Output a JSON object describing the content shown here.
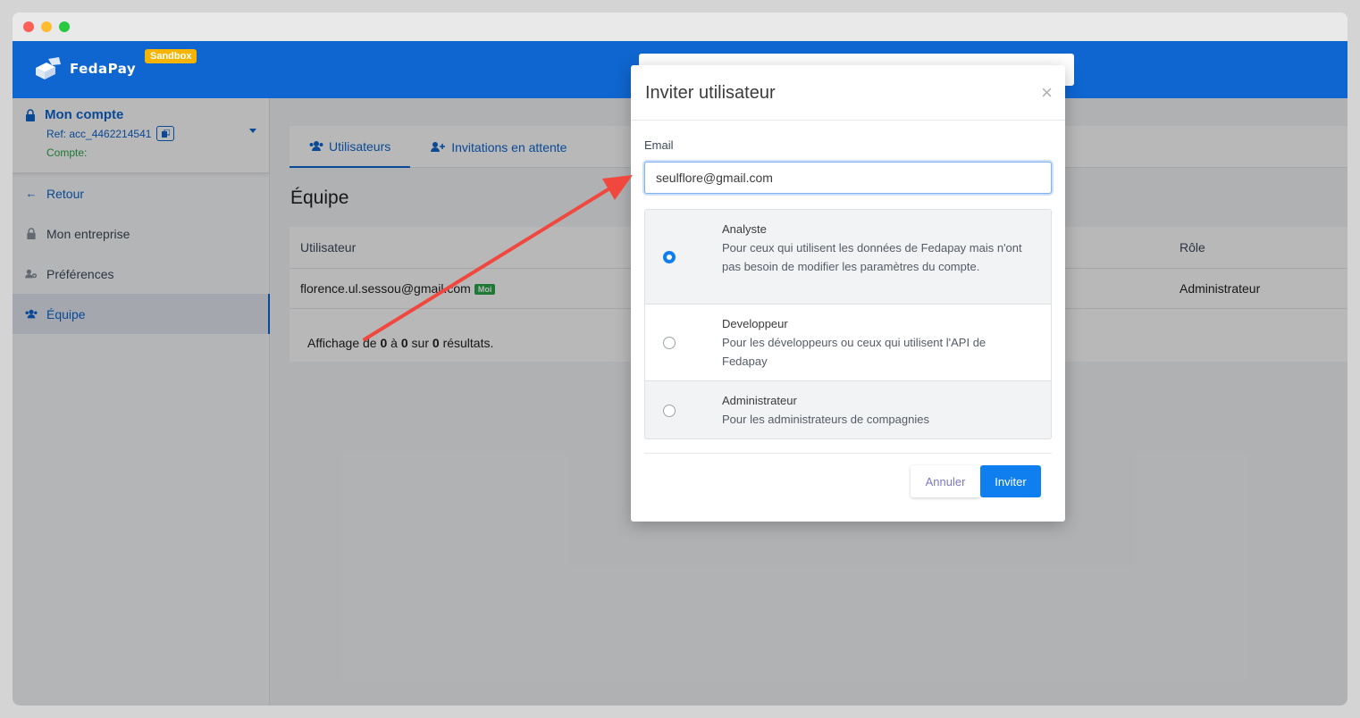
{
  "brand": {
    "name": "FedaPay",
    "env_badge": "Sandbox"
  },
  "sidebar": {
    "account": {
      "title": "Mon compte",
      "ref": "Ref: acc_4462214541",
      "compte": "Compte:"
    },
    "items": [
      {
        "label": "Retour",
        "icon": "arrow-left-icon"
      },
      {
        "label": "Mon entreprise",
        "icon": "lock-icon"
      },
      {
        "label": "Préférences",
        "icon": "user-gear-icon"
      },
      {
        "label": "Équipe",
        "icon": "users-icon",
        "active": true
      }
    ]
  },
  "main": {
    "tabs": [
      {
        "label": "Utilisateurs",
        "icon": "users-icon",
        "active": true
      },
      {
        "label": "Invitations en attente",
        "icon": "user-plus-icon"
      }
    ],
    "title": "Équipe",
    "table": {
      "headers": [
        "Utilisateur",
        "Rôle"
      ],
      "rows": [
        {
          "user": "florence.ul.sessou@gmail.com",
          "badge": "Moi",
          "role": "Administrateur"
        }
      ],
      "footer": {
        "prefix": "Affichage de ",
        "from": "0",
        "mid1": " à ",
        "to": "0",
        "mid2": " sur ",
        "total": "0",
        "suffix": " résultats."
      }
    }
  },
  "modal": {
    "title": "Inviter utilisateur",
    "close": "×",
    "email_label": "Email",
    "email_value": "seulflore@gmail.com",
    "roles": [
      {
        "name": "Analyste",
        "desc": "Pour ceux qui utilisent les données de Fedapay mais n'ont pas besoin de modifier les paramètres du compte.",
        "checked": true
      },
      {
        "name": "Developpeur",
        "desc": "Pour les développeurs ou ceux qui utilisent l'API de Fedapay",
        "checked": false
      },
      {
        "name": "Administrateur",
        "desc": "Pour les administrateurs de compagnies",
        "checked": false
      }
    ],
    "cancel_label": "Annuler",
    "submit_label": "Inviter"
  },
  "colors": {
    "brand_blue": "#0f66d0",
    "primary_button": "#0f7ff0",
    "annotation_arrow": "#f0483e",
    "badge_green": "#2aa84b",
    "sandbox_yellow": "#f4b400"
  }
}
